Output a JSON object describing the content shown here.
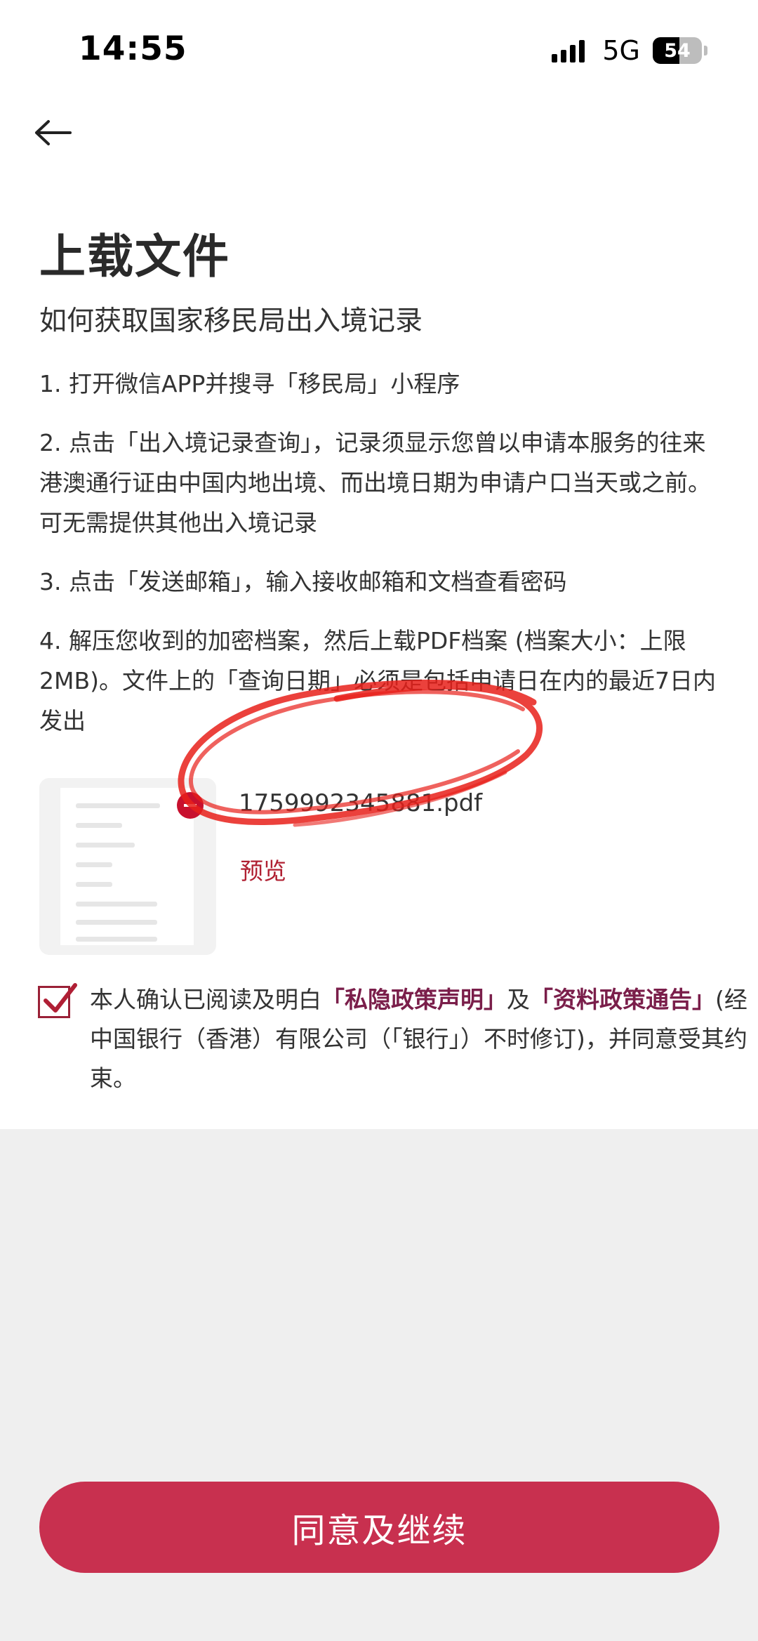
{
  "status_bar": {
    "time": "14:55",
    "network": "5G",
    "battery": "54",
    "battery_level": 0.54,
    "icons": [
      "signal-icon",
      "battery-icon"
    ]
  },
  "header": {
    "back_icon": "arrow-left-icon",
    "title": "上载文件"
  },
  "instructions": {
    "subtitle": "如何获取国家移民局出入境记录",
    "steps": [
      "1. 打开微信APP并搜寻「移民局」小程序",
      "2. 点击「出入境记录查询」，记录须显示您曾以申请本服务的往来港澳通行证由中国内地出境、而出境日期为申请户口当天或之前。可无需提供其他出入境记录",
      "3. 点击「发送邮箱」，输入接收邮箱和文档查看密码",
      "4. 解压您收到的加密档案，然后上载PDF档案 (档案大小：上限2MB)。文件上的「查询日期」必须是包括申请日在内的最近7日内发出"
    ]
  },
  "file": {
    "name": "1759992345881.pdf",
    "preview_label": "预览",
    "thumbnail_icon": "document-icon",
    "remove_icon": "remove-icon"
  },
  "consent": {
    "checked": true,
    "text_before": "本人确认已阅读及明白",
    "privacy_link": "「私隐政策声明」",
    "and": "及",
    "data_policy_link": "「资料政策通告」",
    "text_after": "(经中国银行（香港）有限公司（「银行」）不时修订)，并同意受其约束。"
  },
  "continue_button": "同意及继续",
  "colors": {
    "accent": "#c8304f",
    "link": "#7a1e4a",
    "annotation": "#e8201a"
  }
}
